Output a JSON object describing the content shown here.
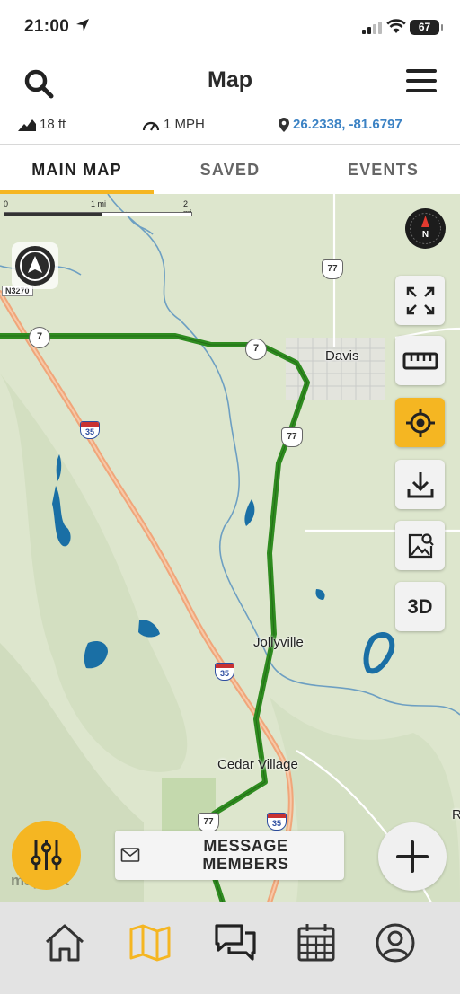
{
  "status_bar": {
    "time": "21:00",
    "battery": "67"
  },
  "header": {
    "title": "Map"
  },
  "stats": {
    "elevation": "18 ft",
    "speed": "1 MPH",
    "coordinates": "26.2338, -81.6797"
  },
  "tabs": [
    {
      "label": "MAIN MAP",
      "active": true
    },
    {
      "label": "SAVED",
      "active": false
    },
    {
      "label": "EVENTS",
      "active": false
    }
  ],
  "map": {
    "scale": {
      "start": "0",
      "mid": "1 mi",
      "end": "2 mi"
    },
    "places": [
      "Davis",
      "Jollyville",
      "Cedar Village"
    ],
    "edge_label": "R",
    "road_tag": "N3270",
    "highway_shields": {
      "route_7": "7",
      "route_77": "77",
      "interstate_35": "35"
    },
    "attribution": "mapbox",
    "colors": {
      "route": "#2e8b1f",
      "interstate": "#f0a67a",
      "water": "#1a6fa5",
      "land": "#dde6cd",
      "accent": "#f5b622"
    }
  },
  "side_buttons": {
    "three_d_label": "3D"
  },
  "message_button": {
    "line1": "MESSAGE",
    "line2": "MEMBERS"
  },
  "bottom_nav": [
    "home",
    "map",
    "chat",
    "calendar",
    "profile"
  ]
}
